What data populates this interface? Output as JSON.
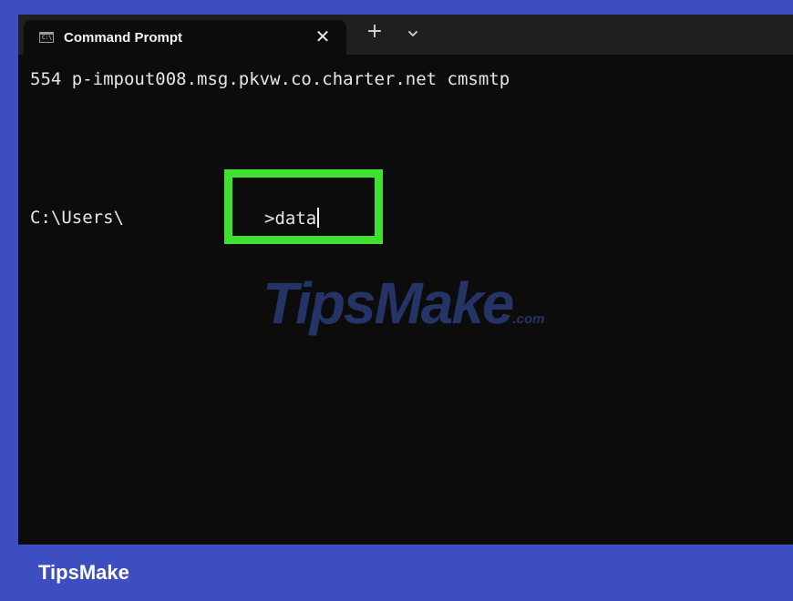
{
  "tab": {
    "title": "Command Prompt",
    "icon_text": "C:\\",
    "close_glyph": "✕"
  },
  "tabbar": {
    "new_tab_glyph": "+"
  },
  "terminal": {
    "line1": "554 p-impout008.msg.pkvw.co.charter.net cmsmtp",
    "prompt": "C:\\Users\\",
    "command": ">data",
    "highlight_color": "#3ee032",
    "background": "#0c0c0c"
  },
  "watermark": {
    "main": "TipsMake",
    "suffix": ".com"
  },
  "footer": {
    "brand": "TipsMake",
    "background": "#3d4fc0"
  },
  "icons": [
    "command-prompt-icon",
    "close-icon",
    "plus-icon",
    "chevron-down-icon"
  ]
}
